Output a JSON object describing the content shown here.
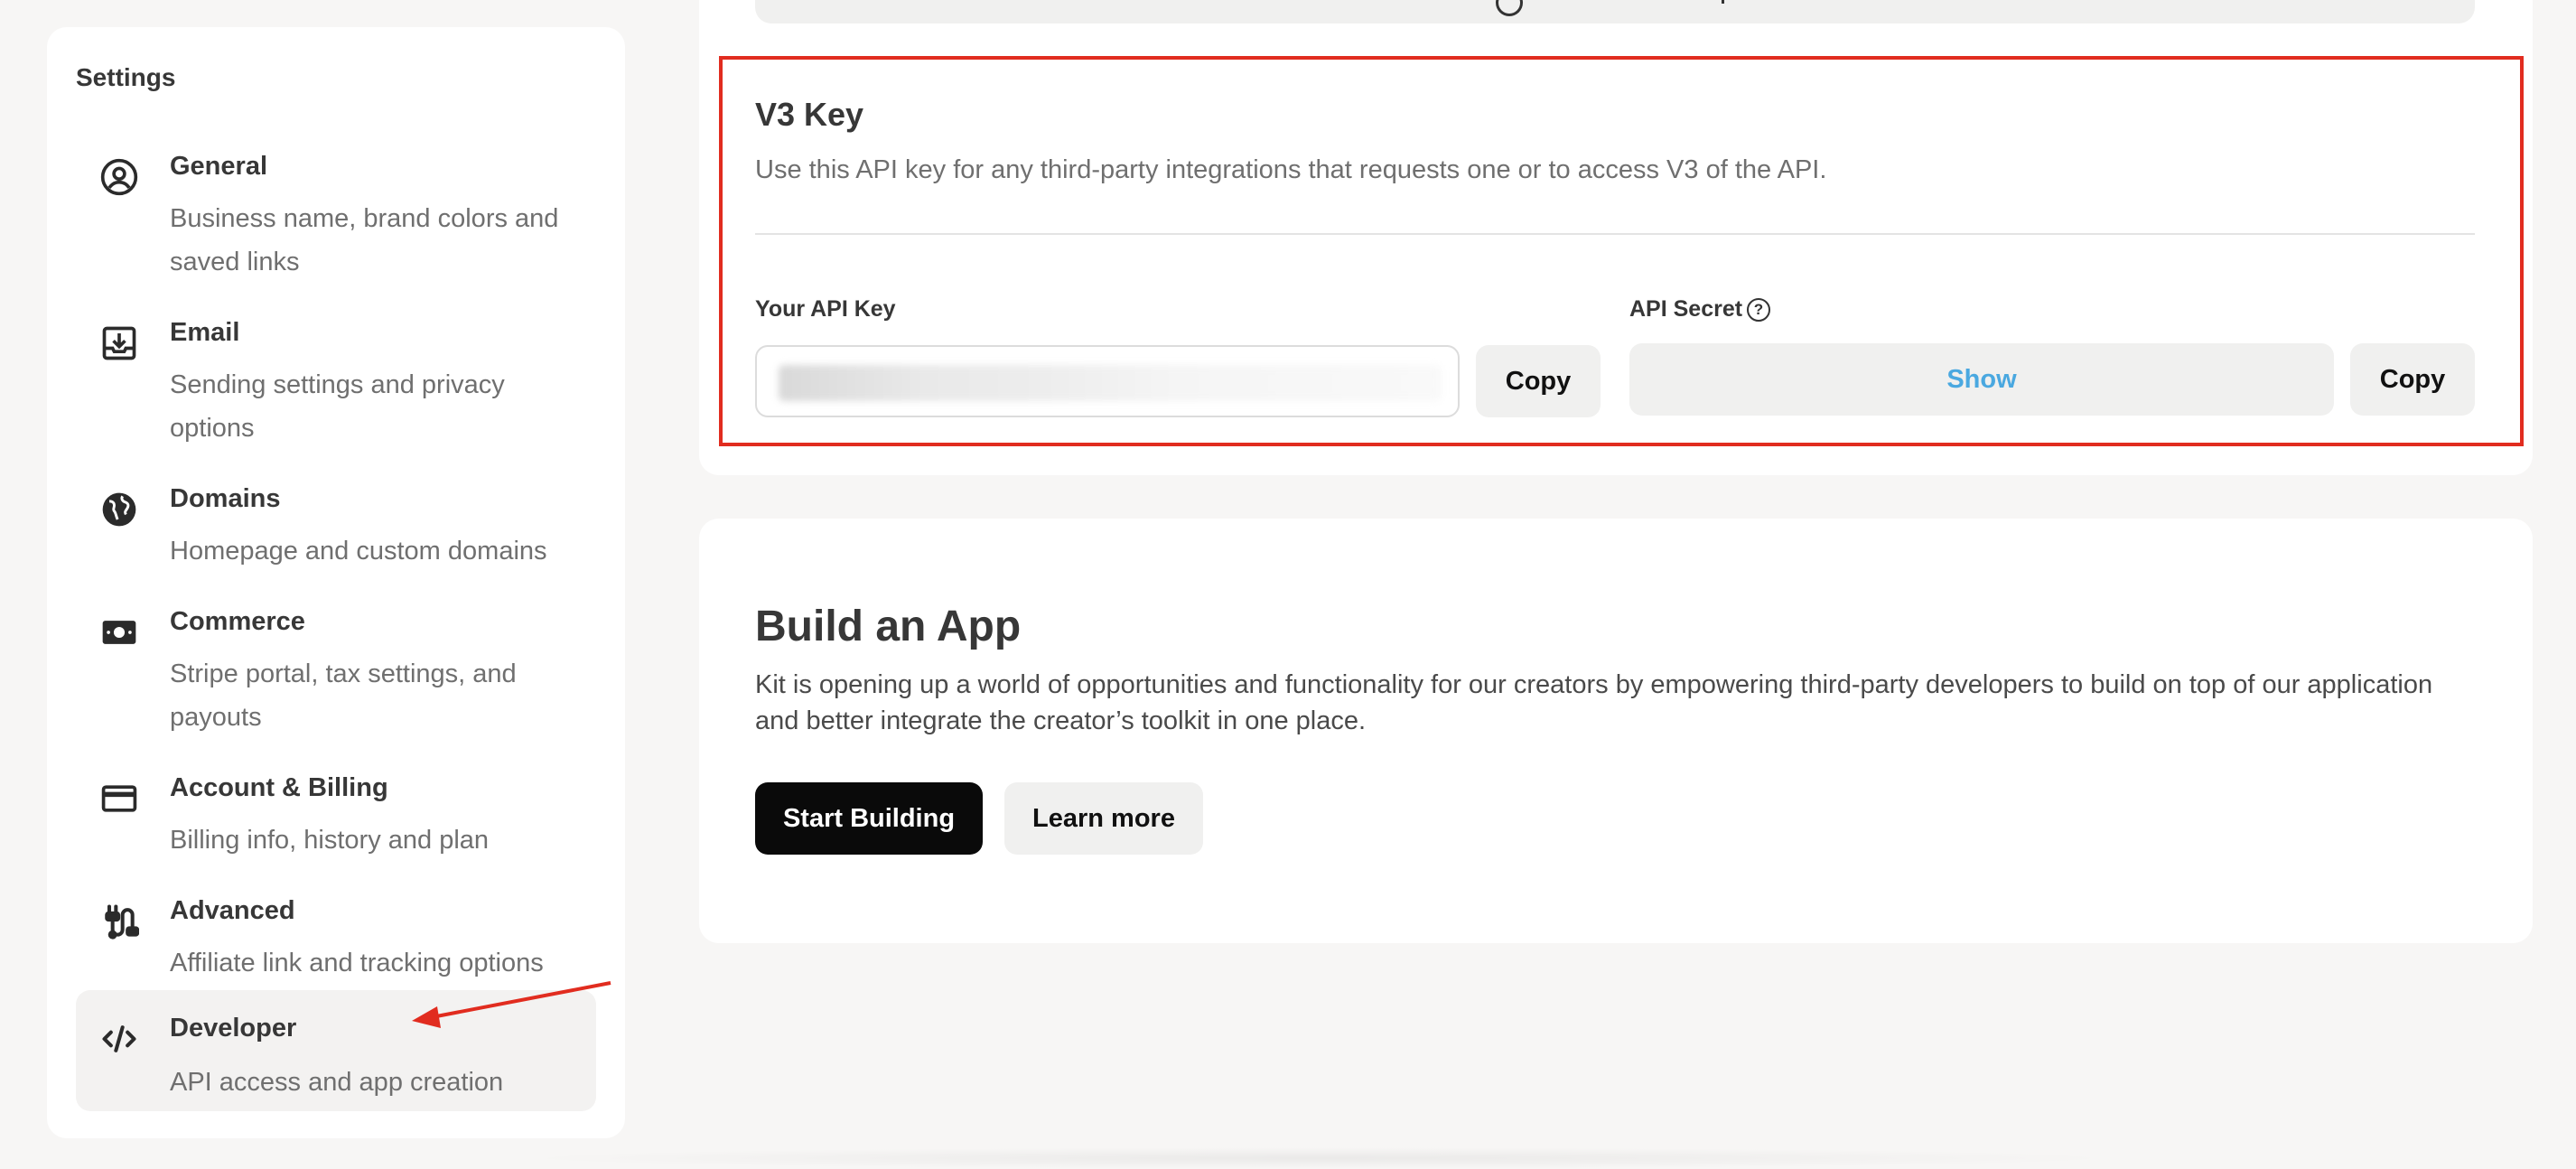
{
  "sidebar": {
    "title": "Settings",
    "items": [
      {
        "label": "General",
        "desc": "Business name, brand colors and saved links",
        "icon": "user-circle-icon"
      },
      {
        "label": "Email",
        "desc": "Sending settings and privacy options",
        "icon": "inbox-download-icon"
      },
      {
        "label": "Domains",
        "desc": "Homepage and custom domains",
        "icon": "globe-icon"
      },
      {
        "label": "Commerce",
        "desc": "Stripe portal, tax settings, and payouts",
        "icon": "cash-icon"
      },
      {
        "label": "Account & Billing",
        "desc": "Billing info, history and plan",
        "icon": "credit-card-icon"
      },
      {
        "label": "Advanced",
        "desc": "Affiliate link and tracking options",
        "icon": "plug-icon"
      },
      {
        "label": "Developer",
        "desc": "API access and app creation",
        "icon": "code-icon",
        "active": true
      }
    ]
  },
  "v3": {
    "title": "V3 Key",
    "description": "Use this API key for any third-party integrations that requests one or to access V3 of the API.",
    "api_key_label": "Your API Key",
    "api_key_value": "",
    "copy_label": "Copy",
    "secret_label": "API Secret",
    "help_glyph": "?",
    "show_label": "Show",
    "secret_copy_label": "Copy"
  },
  "build_app": {
    "title": "Build an App",
    "description": "Kit is opening up a world of opportunities and functionality for our creators by empowering third-party developers to build on top of our application and better integrate the creator’s toolkit in one place.",
    "primary_label": "Start Building",
    "secondary_label": "Learn more"
  },
  "colors": {
    "highlight": "#e12c1f",
    "show_link": "#4aa8e0",
    "primary_button": "#0a0a0a"
  }
}
